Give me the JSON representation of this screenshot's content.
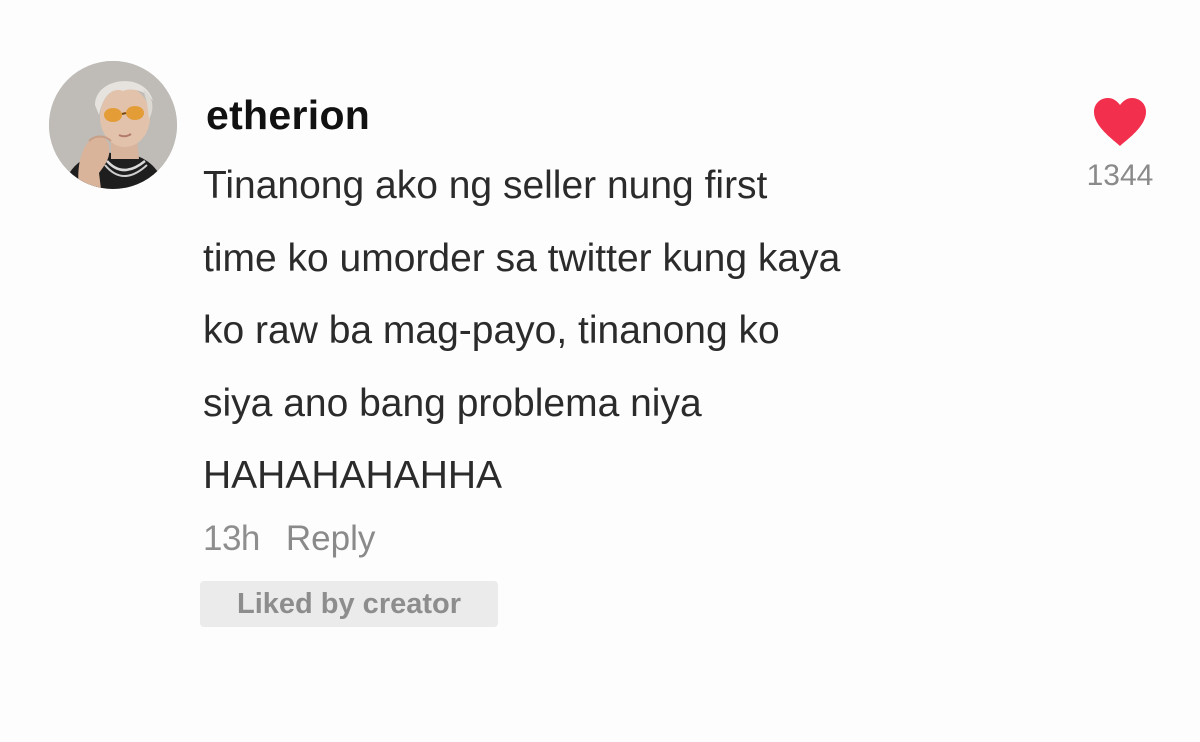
{
  "comment": {
    "avatar_icon": "user-avatar-photo",
    "username": "etherion",
    "lines": [
      "Tinanong ako ng seller nung first",
      "time ko umorder sa twitter kung kaya",
      "ko raw ba mag-payo, tinanong ko",
      "siya ano bang problema niya",
      "HAHAHAHAHHA"
    ],
    "timestamp": "13h",
    "reply_label": "Reply",
    "liked_by_creator_label": "Liked by creator",
    "like_icon": "heart-icon",
    "like_count": "1344"
  },
  "colors": {
    "heart": "#f2304e",
    "username": "#111111",
    "body": "#2b2b2b",
    "muted": "#8e8e8e",
    "badge_bg": "#ebebeb"
  }
}
